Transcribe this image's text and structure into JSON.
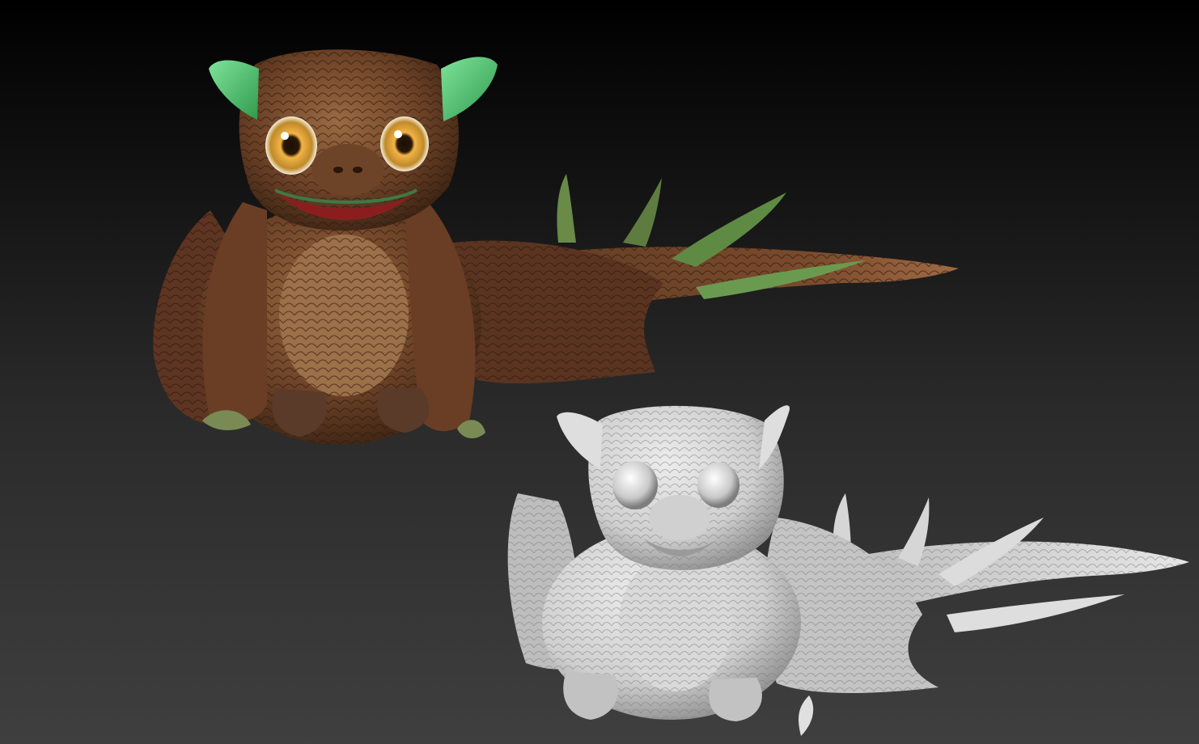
{
  "scene": {
    "background": {
      "top": "#000000",
      "bottom": "#3f3f3f"
    },
    "models": [
      {
        "label": "",
        "style": "textured",
        "colors": {
          "skin": "#6b4126",
          "skin_light": "#9b6a42",
          "skin_dark": "#3a2212",
          "ear": "#47c06a",
          "eye_iris": "#c08a2a",
          "mouth": "#8a1e1e"
        }
      },
      {
        "label": "",
        "style": "clay",
        "colors": {
          "clay": "#cfcfcf",
          "clay_light": "#ececec",
          "clay_dark": "#8c8c8c"
        }
      }
    ]
  }
}
